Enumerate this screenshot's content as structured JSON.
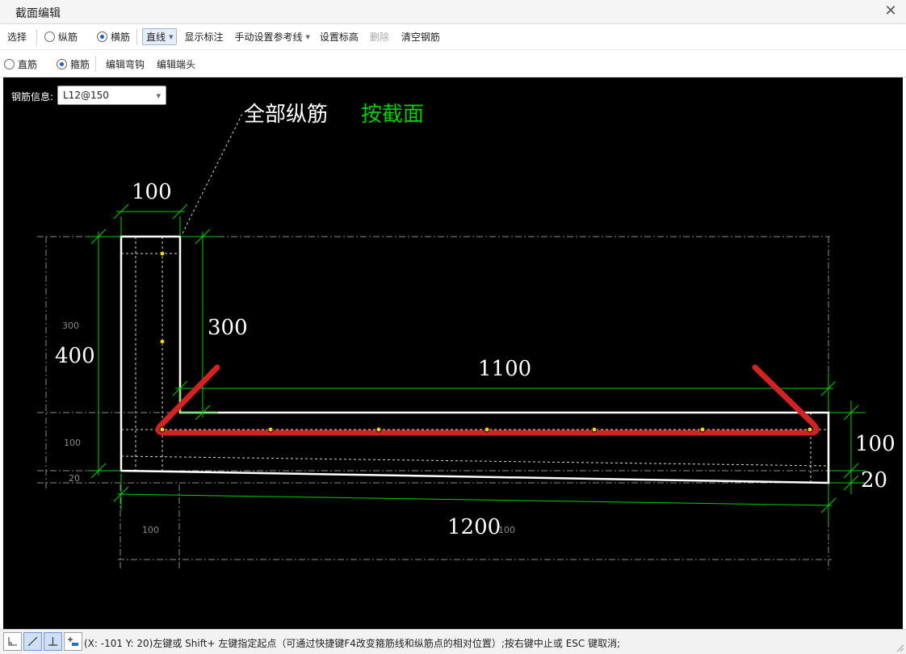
{
  "window": {
    "title": "截面编辑",
    "close_icon": "close-icon"
  },
  "toolbar1": {
    "select": "选择",
    "longitudinal": "纵筋",
    "transverse": "横筋",
    "line_mode": "直线",
    "show_dimensions": "显示标注",
    "manual_reference": "手动设置参考线",
    "set_elevation": "设置标高",
    "delete": "删除",
    "clear_rebar": "清空钢筋"
  },
  "toolbar2": {
    "straight": "直筋",
    "stirrup": "箍筋",
    "edit_hook": "编辑弯钩",
    "edit_end": "编辑端头"
  },
  "rebar_info": {
    "label": "钢筋信息:",
    "value": "L12@150"
  },
  "drawing": {
    "annotation_main": "全部纵筋",
    "annotation_mode": "按截面",
    "dims_big": {
      "top_width": "100",
      "left_height": "400",
      "inner_height": "300",
      "span": "1100",
      "right_height": "100",
      "right_bottom": "20",
      "total_length": "1200"
    },
    "dims_small": {
      "left_300": "300",
      "left_100": "100",
      "left_20": "20",
      "bottom_100": "100",
      "bottom_right_100": "100"
    },
    "colors": {
      "section_outline": "#ffffff",
      "dimension_line": "#00d000",
      "rebar": "#d62020",
      "rebar_point": "#f0d020",
      "mode_text": "#00d000"
    }
  },
  "statusbar": {
    "text": "(X: -101 Y: 20)左键或 Shift+ 左键指定起点（可通过快捷键F4改变箍筋线和纵筋点的相对位置）;按右键中止或 ESC 键取消;",
    "icons": [
      "orthogonal-icon",
      "line-icon",
      "perpendicular-icon",
      "add-point-icon"
    ]
  }
}
